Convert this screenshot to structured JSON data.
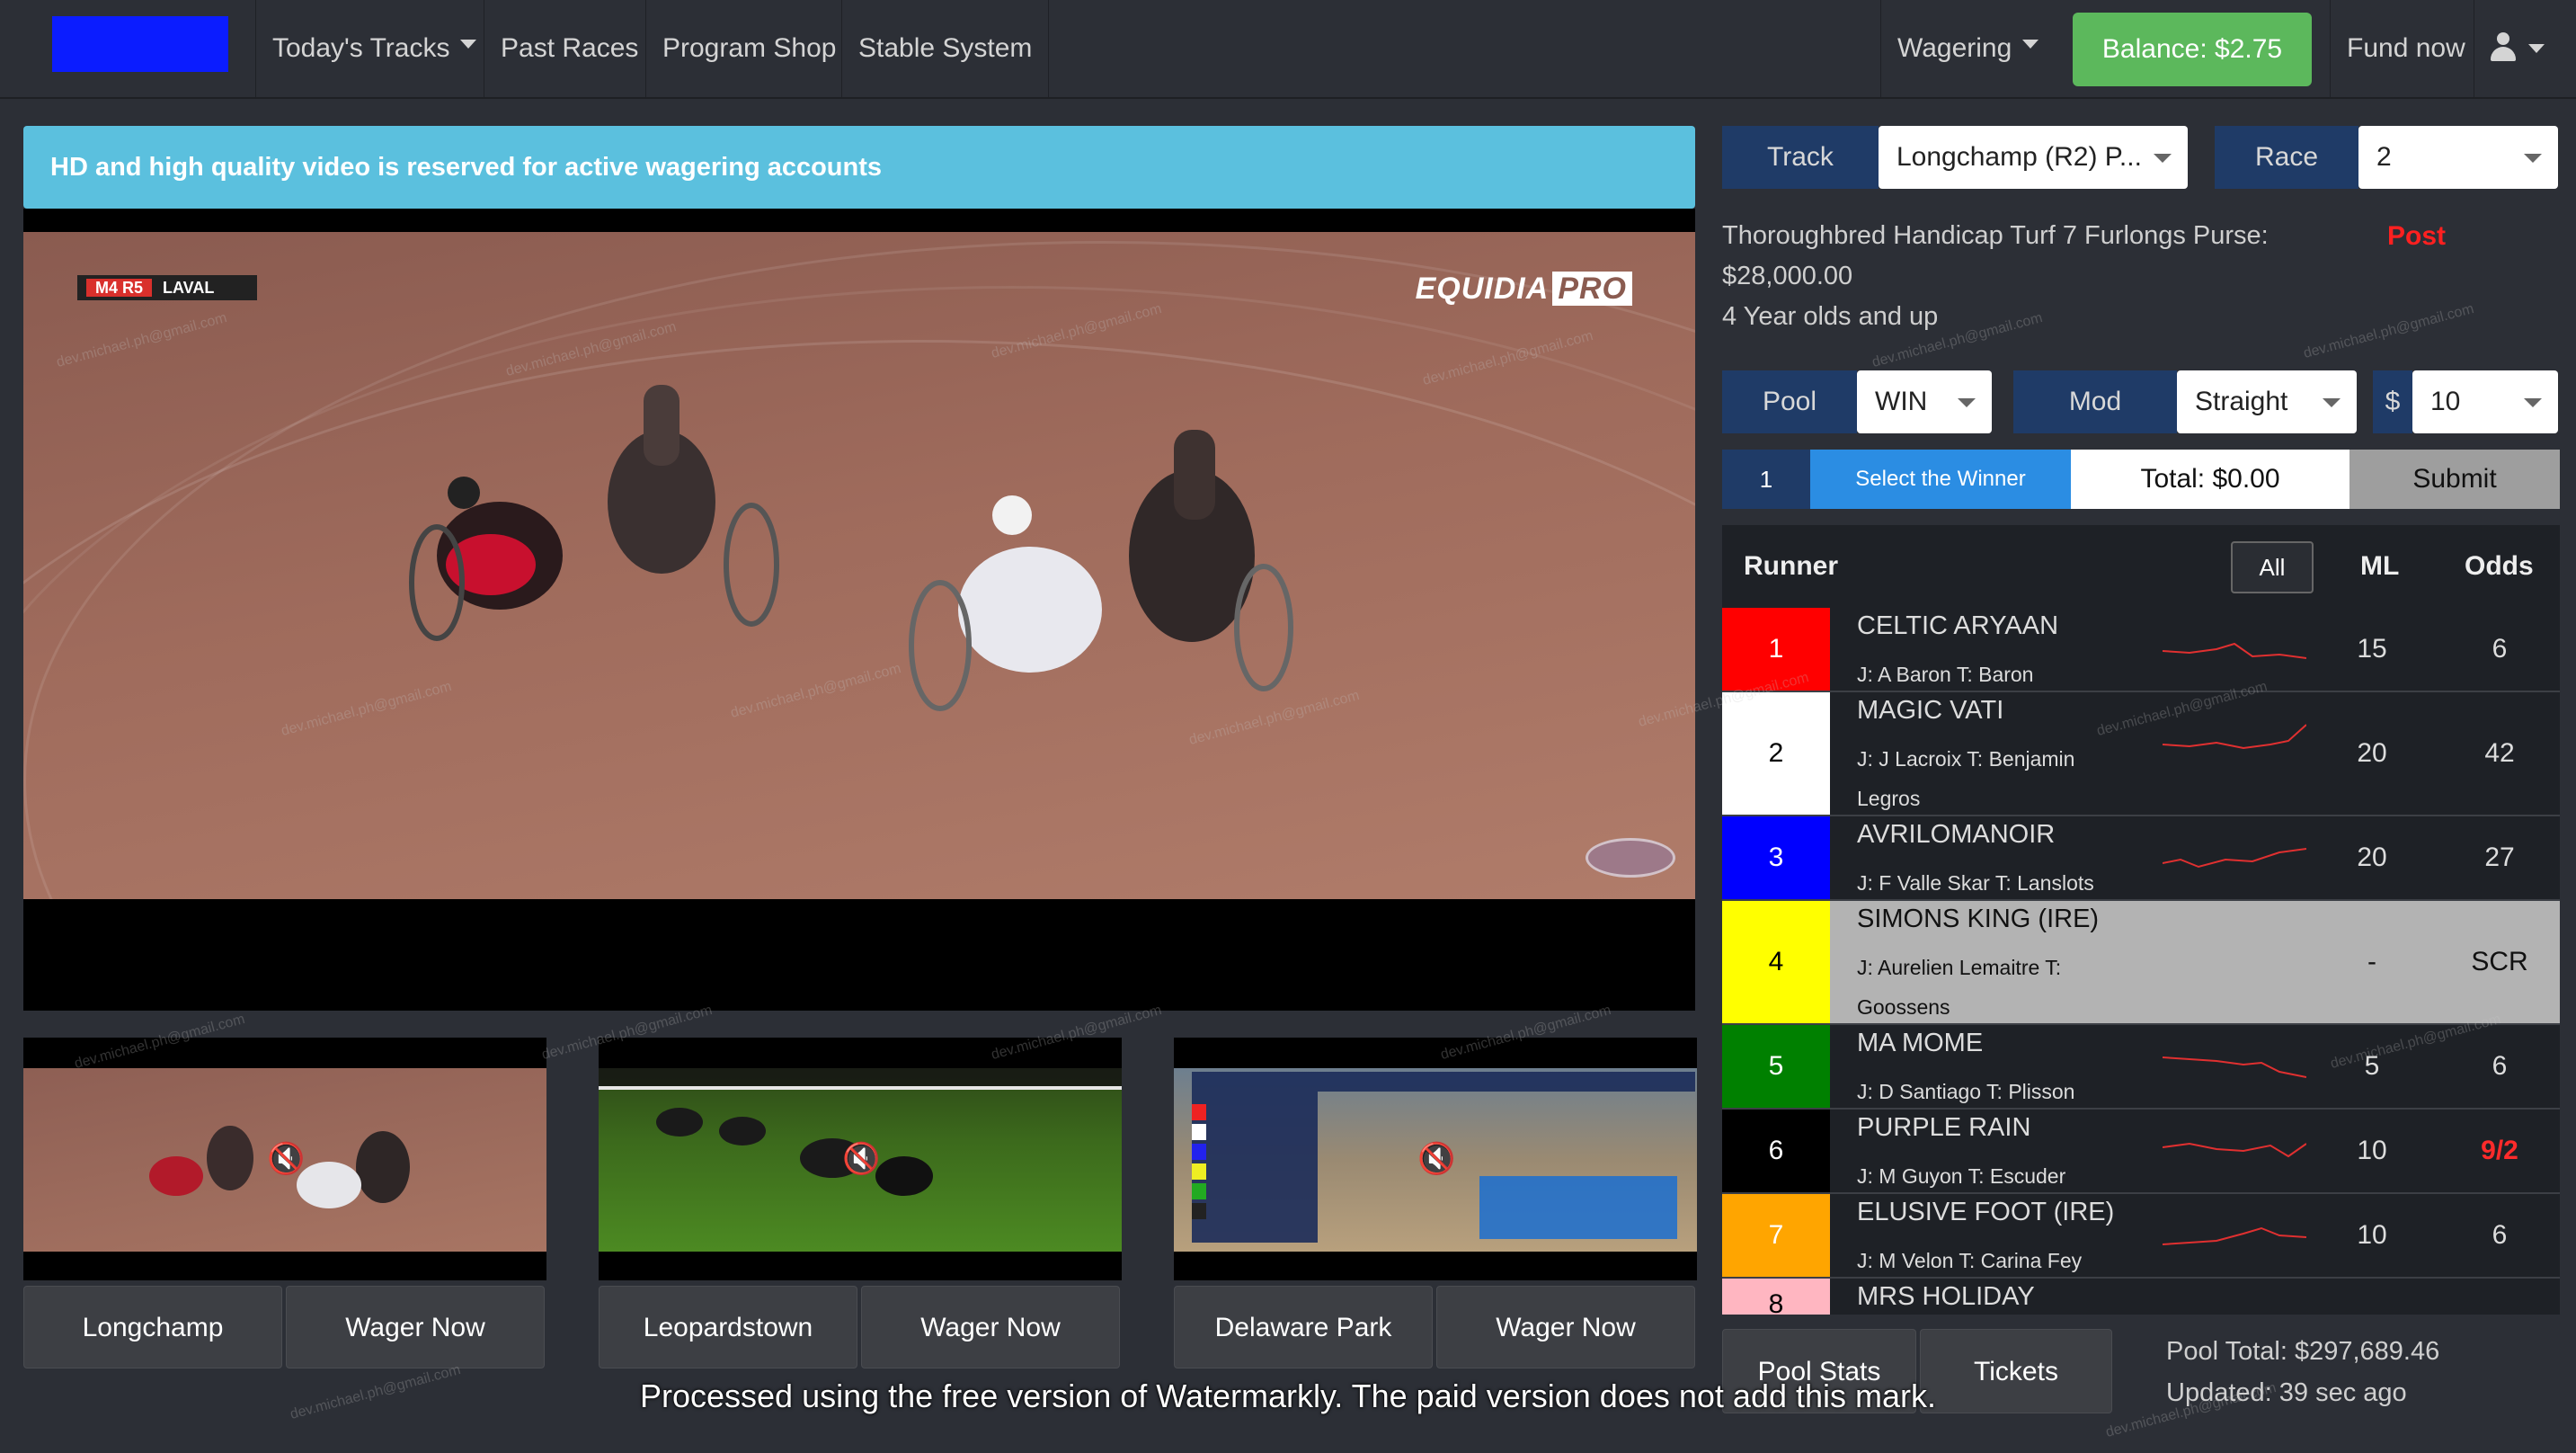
{
  "nav": {
    "todays_tracks": "Today's Tracks",
    "past_races": "Past Races",
    "program_shop": "Program Shop",
    "stable_system": "Stable System",
    "wagering": "Wagering",
    "balance": "Balance: $2.75",
    "fund_now": "Fund now"
  },
  "video": {
    "hd_notice": "HD and high quality video is reserved for active wagering accounts",
    "badge_left": "M4 R5",
    "badge_right": "LAVAL",
    "brand": "EQUIDIA",
    "brand_suffix": "PRO"
  },
  "thumbnails": [
    {
      "track": "Longchamp",
      "wager": "Wager Now"
    },
    {
      "track": "Leopardstown",
      "wager": "Wager Now"
    },
    {
      "track": "Delaware Park",
      "wager": "Wager Now"
    }
  ],
  "selector": {
    "track_label": "Track",
    "track_value": "Longchamp (R2) P...",
    "race_label": "Race",
    "race_value": "2"
  },
  "race_info": {
    "line1": "Thoroughbred  Handicap Turf 7 Furlongs  Purse:",
    "line2": "$28,000.00",
    "line3": "4 Year olds and up",
    "post": "Post"
  },
  "bet": {
    "pool_label": "Pool",
    "pool_value": "WIN",
    "mod_label": "Mod",
    "mod_value": "Straight",
    "dollar_label": "$",
    "amount_value": "10"
  },
  "slip": {
    "num": "1",
    "select_text": "Select the Winner",
    "total": "Total: $0.00",
    "submit": "Submit"
  },
  "runner_table": {
    "col_runner": "Runner",
    "all_btn": "All",
    "col_ml": "ML",
    "col_odds": "Odds"
  },
  "runners": [
    {
      "num": "1",
      "name": "CELTIC ARYAAN",
      "jt": "J: A Baron T: Baron",
      "ml": "15",
      "odds": "6",
      "color": "#ff0000",
      "num_color": "#ffffff",
      "odds_red": false,
      "scratched": false
    },
    {
      "num": "2",
      "name": "MAGIC VATI",
      "jt": "J: J Lacroix T: Benjamin Legros",
      "ml": "20",
      "odds": "42",
      "color": "#ffffff",
      "num_color": "#000000",
      "odds_red": false,
      "scratched": false
    },
    {
      "num": "3",
      "name": "AVRILOMANOIR",
      "jt": "J: F Valle Skar T: Lanslots",
      "ml": "20",
      "odds": "27",
      "color": "#0000ff",
      "num_color": "#ffffff",
      "odds_red": false,
      "scratched": false
    },
    {
      "num": "4",
      "name": "SIMONS KING (IRE)",
      "jt": "J: Aurelien Lemaitre T: Goossens",
      "ml": "-",
      "odds": "SCR",
      "color": "#ffff00",
      "num_color": "#000000",
      "odds_red": false,
      "scratched": true
    },
    {
      "num": "5",
      "name": "MA MOME",
      "jt": "J: D Santiago T: Plisson",
      "ml": "5",
      "odds": "6",
      "color": "#008000",
      "num_color": "#ffffff",
      "odds_red": false,
      "scratched": false
    },
    {
      "num": "6",
      "name": "PURPLE RAIN",
      "jt": "J: M Guyon T: Escuder",
      "ml": "10",
      "odds": "9/2",
      "color": "#000000",
      "num_color": "#ffffff",
      "odds_red": true,
      "scratched": false
    },
    {
      "num": "7",
      "name": "ELUSIVE FOOT (IRE)",
      "jt": "J: M Velon T: Carina Fey",
      "ml": "10",
      "odds": "6",
      "color": "#ffa500",
      "num_color": "#ffffff",
      "odds_red": false,
      "scratched": false
    },
    {
      "num": "8",
      "name": "MRS HOLIDAY",
      "jt": "",
      "ml": "",
      "odds": "",
      "color": "#ffb6c1",
      "num_color": "#000000",
      "odds_red": false,
      "scratched": false
    }
  ],
  "footer": {
    "pool_stats": "Pool Stats",
    "tickets": "Tickets",
    "pool_total": "Pool Total: $297,689.46",
    "updated": "Updated: 39 sec ago",
    "watermark_note": "Processed using the free version of Watermarkly. The paid version does not add this mark.",
    "watermark_email": "dev.michael.ph@gmail.com"
  }
}
